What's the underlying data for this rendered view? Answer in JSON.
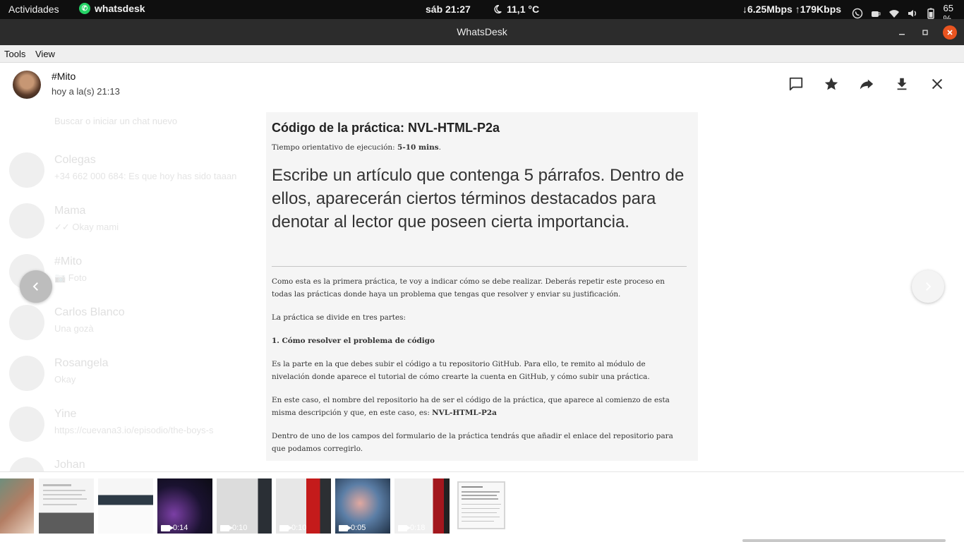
{
  "topbar": {
    "activities": "Actividades",
    "app_name": "whatsdesk",
    "datetime": "sáb 21:27",
    "weather": "11,1 °C",
    "network": "↓6.25Mbps ↑179Kbps",
    "battery": "65 %"
  },
  "window": {
    "title": "WhatsDesk"
  },
  "menu": {
    "tools": "Tools",
    "view": "View"
  },
  "viewer": {
    "contact_name": "#Mito",
    "timestamp": "hoy a la(s) 21:13"
  },
  "background_list": {
    "search_hint": "Buscar o iniciar un chat nuevo",
    "chats": [
      {
        "name": "Colegas",
        "last": "+34 662 000 684: Es que hoy has sido taaan"
      },
      {
        "name": "Mama",
        "last": "✓✓ Okay mami"
      },
      {
        "name": "#Mito",
        "last": "📷 Foto"
      },
      {
        "name": "Carlos Blanco",
        "last": "Una gozà"
      },
      {
        "name": "Rosangela",
        "last": "Okay"
      },
      {
        "name": "Yine",
        "last": "https://cuevana3.io/episodio/the-boys-s"
      },
      {
        "name": "Johan",
        "last": ""
      }
    ]
  },
  "document": {
    "heading": "Código de la práctica: NVL-HTML-P2a",
    "time_label": "Tiempo orientativo de ejecución:",
    "time_value": "5-10 mins",
    "time_end": ".",
    "statement": "Escribe un artículo que contenga 5 párrafos. Dentro de ellos, aparecerán ciertos términos destacados para denotar al lector que poseen cierta importancia.",
    "p1": "Como esta es la primera práctica, te voy a indicar cómo se debe realizar. Deberás repetir este proceso en todas las prácticas donde haya un problema que tengas que resolver y enviar su justificación.",
    "p2": "La práctica se divide en tres partes:",
    "p3": "1. Cómo resolver el problema de código",
    "p4": "Es la parte en la que debes subir el código a tu repositorio GitHub. Para ello, te remito al módulo de nivelación donde aparece el tutorial de cómo crearte la cuenta en GitHub, y cómo subir una práctica.",
    "p5_text": "En este caso, el nombre del repositorio  ha de ser el código de la práctica, que aparece al comienzo de esta misma descripción y que, en este caso, es: ",
    "p5_code": "NVL-HTML-P2a",
    "p6": "Dentro de uno de los campos del formulario de la práctica tendrás que añadir el enlace del repositorio para que podamos corregirlo."
  },
  "thumbnails": [
    {
      "kind": "image",
      "label": ""
    },
    {
      "kind": "image",
      "label": ""
    },
    {
      "kind": "image",
      "label": ""
    },
    {
      "kind": "video",
      "label": "0:14"
    },
    {
      "kind": "video",
      "label": "0:10"
    },
    {
      "kind": "video",
      "label": "0:10"
    },
    {
      "kind": "video",
      "label": "0:05"
    },
    {
      "kind": "video",
      "label": "0:18"
    },
    {
      "kind": "image",
      "label": ""
    }
  ]
}
